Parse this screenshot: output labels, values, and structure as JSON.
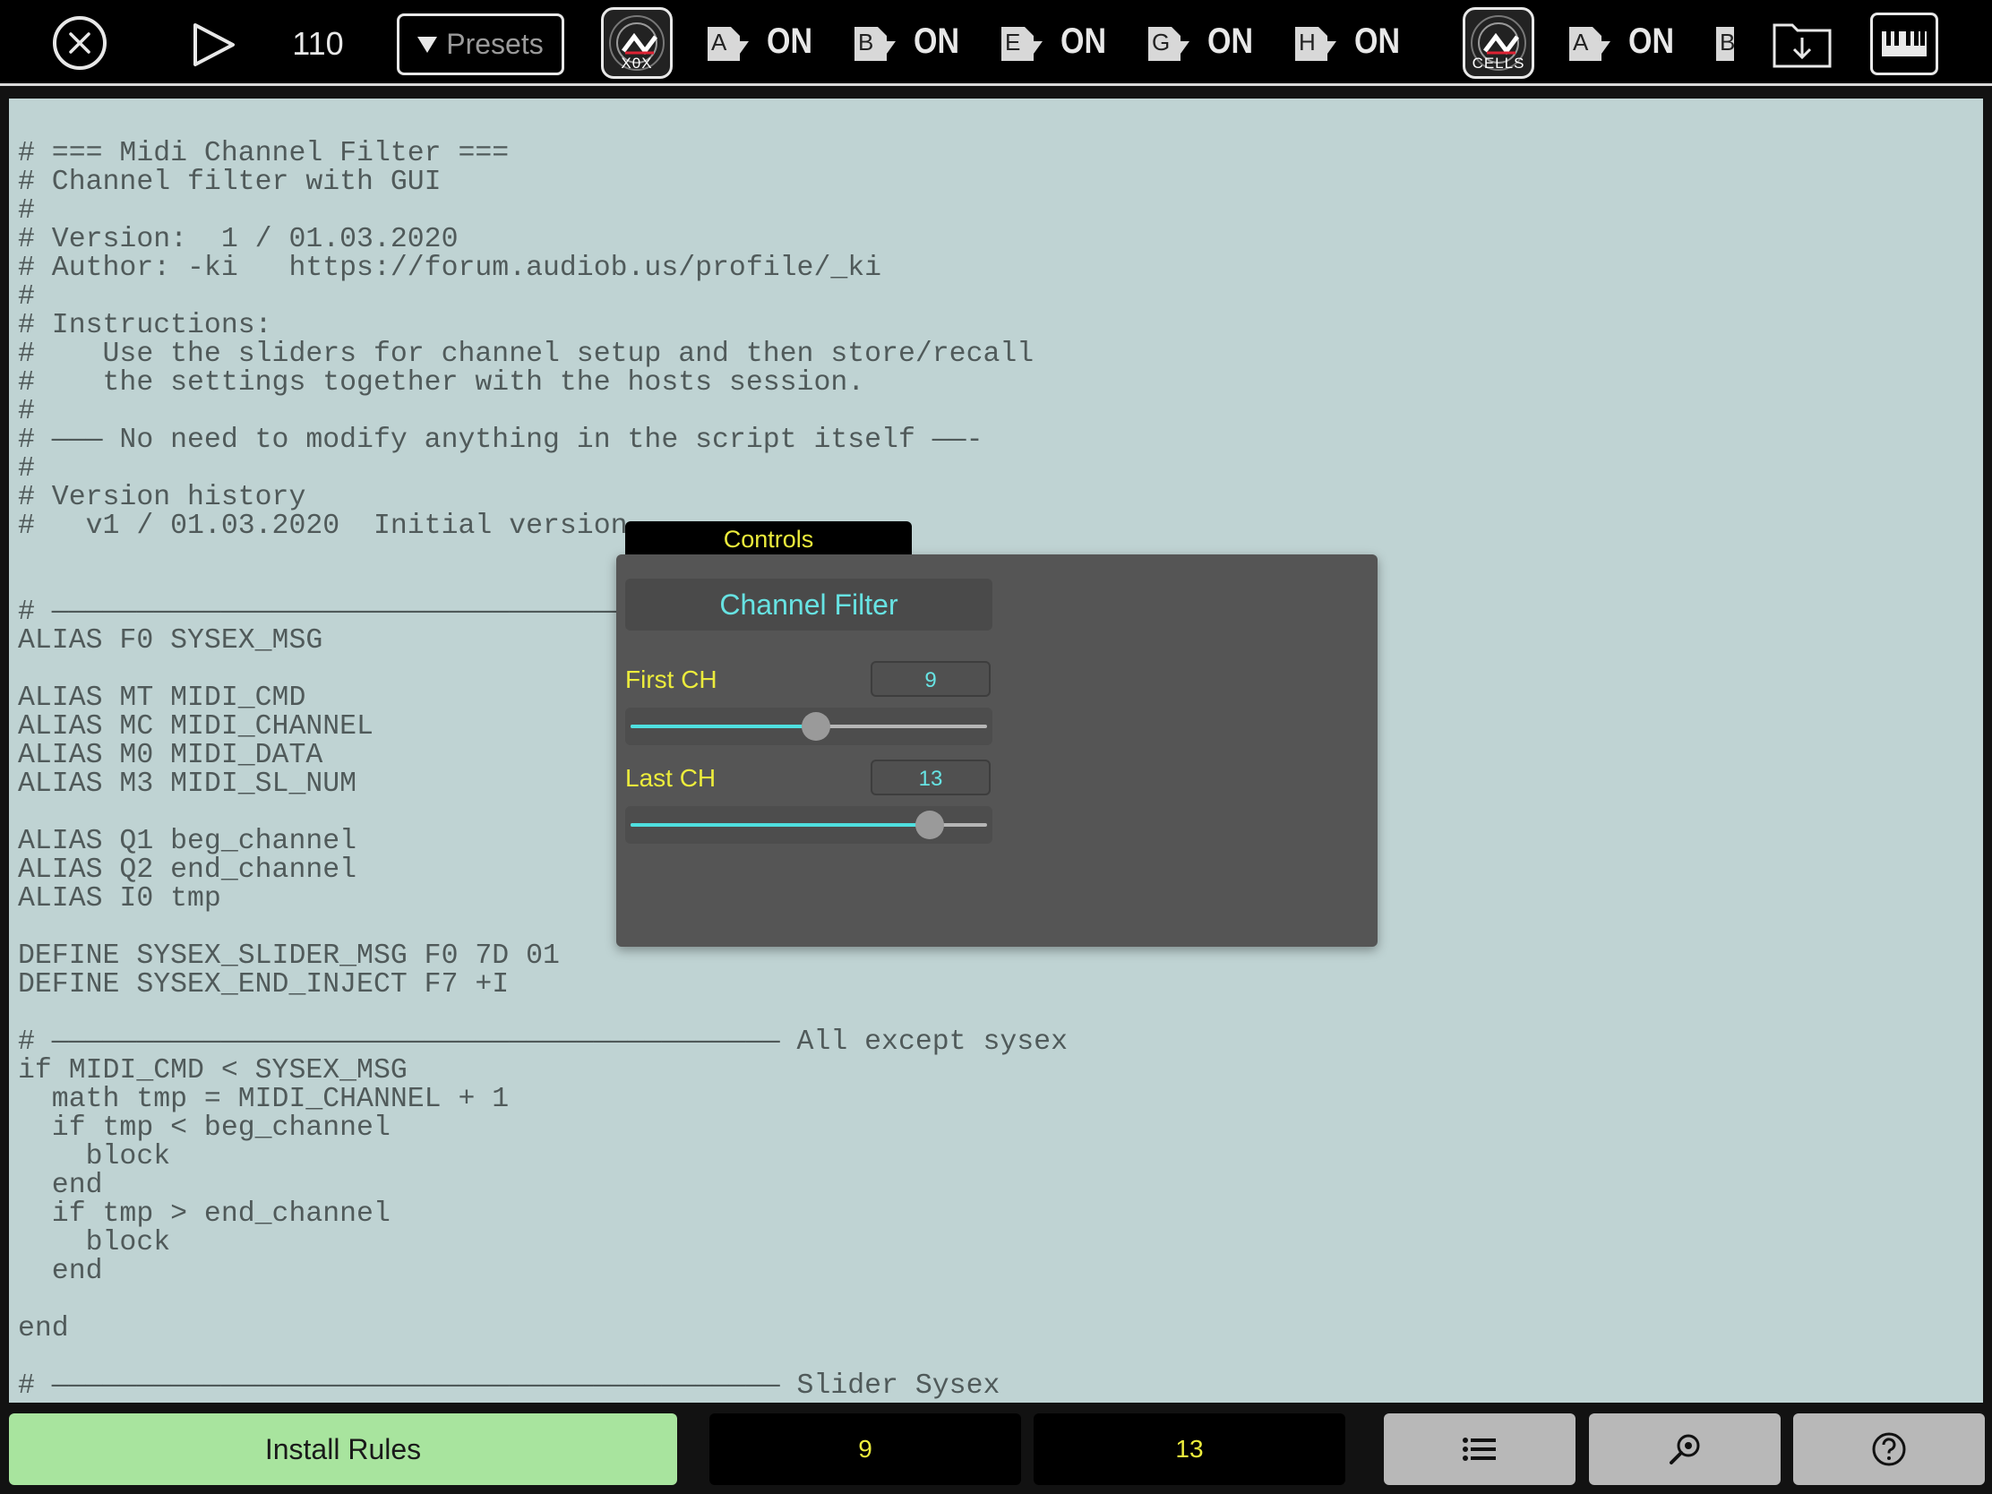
{
  "toolbar": {
    "bpm": "110",
    "presets_label": "Presets",
    "seq_buttons": [
      {
        "label": "X0X"
      },
      {
        "label": "CELLS"
      }
    ],
    "tracks": [
      {
        "letter": "A",
        "state": "ON"
      },
      {
        "letter": "B",
        "state": "ON"
      },
      {
        "letter": "E",
        "state": "ON"
      },
      {
        "letter": "G",
        "state": "ON"
      },
      {
        "letter": "H",
        "state": "ON"
      },
      {
        "letter": "A",
        "state": "ON"
      },
      {
        "letter": "B",
        "state": ""
      }
    ],
    "icons": [
      "close-icon",
      "play-icon",
      "import-folder-icon",
      "keyboard-icon"
    ]
  },
  "editor": {
    "lines": [
      "# === Midi Channel Filter ===",
      "# Channel filter with GUI",
      "#",
      "# Version:  1 / 01.03.2020",
      "# Author: -ki   https://forum.audiob.us/profile/_ki",
      "#",
      "# Instructions:",
      "#    Use the sliders for channel setup and then store/recall",
      "#    the settings together with the hosts session.",
      "#",
      "# ——— No need to modify anything in the script itself ——-",
      "#",
      "# Version history",
      "#   v1 / 01.03.2020  Initial version",
      "",
      "",
      "# ——————————————————————————————————————————",
      "ALIAS F0 SYSEX_MSG",
      "",
      "ALIAS MT MIDI_CMD",
      "ALIAS MC MIDI_CHANNEL",
      "ALIAS M0 MIDI_DATA",
      "ALIAS M3 MIDI_SL_NUM",
      "",
      "ALIAS Q1 beg_channel",
      "ALIAS Q2 end_channel",
      "ALIAS I0 tmp",
      "",
      "DEFINE SYSEX_SLIDER_MSG F0 7D 01",
      "DEFINE SYSEX_END_INJECT F7 +I",
      "",
      "# ——————————————————————————————————————————— All except sysex",
      "if MIDI_CMD < SYSEX_MSG",
      "  math tmp = MIDI_CHANNEL + 1",
      "  if tmp < beg_channel",
      "    block",
      "  end",
      "  if tmp > end_channel",
      "    block",
      "  end",
      "",
      "end",
      "",
      "# ——————————————————————————————————————————— Slider Sysex"
    ]
  },
  "controls": {
    "tab_label": "Controls",
    "title": "Channel Filter",
    "sliders": [
      {
        "label": "First CH",
        "value": "9",
        "level": 0.52
      },
      {
        "label": "Last CH",
        "value": "13",
        "level": 0.84
      }
    ]
  },
  "bottom_bar": {
    "install_label": "Install Rules",
    "first_value": "9",
    "last_value": "13",
    "icons": [
      "list-icon",
      "search-icon",
      "help-icon"
    ]
  },
  "colors": {
    "editor_bg": "#bfd3d3",
    "accent_cyan": "#67e3e3",
    "label_yellow": "#ecec3c",
    "install_green": "#a8e49e"
  }
}
